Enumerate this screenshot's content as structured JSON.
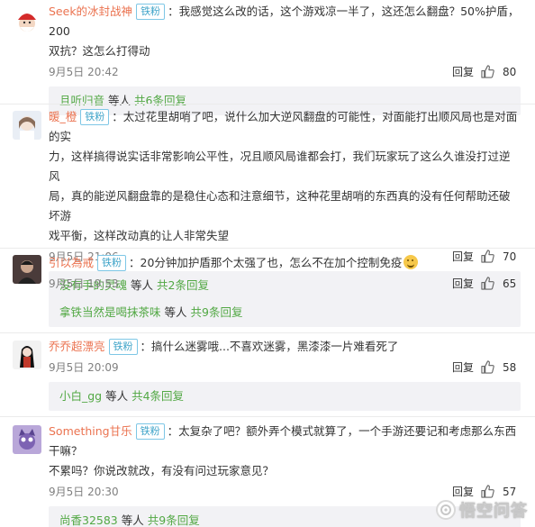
{
  "labels": {
    "badge": "铁粉",
    "reply": "回复",
    "people_suffix": " 等人 ",
    "reply_prefix": "共",
    "reply_suffix": "条回复"
  },
  "comments": [
    {
      "username": "Seek的冰封战神",
      "lines": [
        "：我感觉这么改的话，这个游戏凉一半了，这还怎么翻盘？50%护盾，200",
        "双抗？这怎么打得动"
      ],
      "date": "9月5日 20:42",
      "likes": "80",
      "reply_user": "且听归音",
      "reply_count": "6"
    },
    {
      "username": "暖_橙",
      "lines": [
        "：太过花里胡哨了吧，说什么加大逆风翻盘的可能性，对面能打出顺风局也是对面的实",
        "力，这样搞得说实话非常影响公平性，况且顺风局谁都会打，我们玩家玩了这么久谁没打过逆风",
        "局，真的能逆风翻盘靠的是稳住心态和注意细节，这种花里胡哨的东西真的没有任何帮助还破坏游",
        "戏平衡，这样改动真的让人非常失望"
      ],
      "date": "9月5日 21:06",
      "likes": "70",
      "reply_user": "没有手的灵魂",
      "reply_count": "2"
    },
    {
      "username": "引以為戒",
      "lines": [
        "：20分钟加护盾那个太强了也，怎么不在加个控制免疫"
      ],
      "date": "9月5日 19:53",
      "likes": "65",
      "reply_user": "拿铁当然是喝抹茶味",
      "reply_count": "9"
    },
    {
      "username": "乔乔超漂亮",
      "lines": [
        "：搞什么迷雾哦...不喜欢迷雾，黑漆漆一片难看死了"
      ],
      "date": "9月5日 20:09",
      "likes": "58",
      "reply_user": "小白_gg",
      "reply_count": "4"
    },
    {
      "username": "Something甘乐",
      "lines": [
        "：太复杂了吧？额外弄个模式就算了，一个手游还要记和考虑那么东西干嘛？",
        "不累吗？你说改就改，有没有问过玩家意见？"
      ],
      "date": "9月5日 20:30",
      "likes": "57",
      "reply_user": "尚香32583",
      "reply_count": "9"
    }
  ],
  "watermark": "悟空问答",
  "colors": {
    "username": "#eb7350",
    "reply_user": "#52a844",
    "badge": "#3da3c8",
    "reply_bg": "#f2f2f5"
  },
  "icons": [
    "avatar",
    "thumbs-up-icon",
    "smile-emoji-icon",
    "wukong-logo-icon"
  ]
}
